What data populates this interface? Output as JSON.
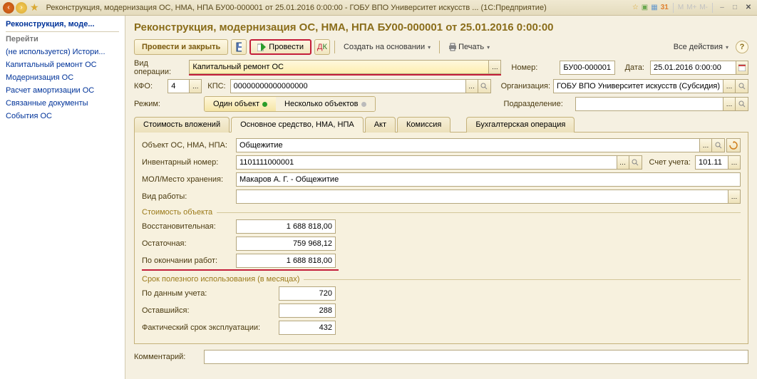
{
  "titlebar": {
    "title": "Реконструкция, модернизация ОС, НМА, НПА БУ00-000001 от 25.01.2016 0:00:00 - ГОБУ ВПО Университет искусств ... (1С:Предприятие)",
    "m": "M",
    "m_plus": "M+",
    "m_minus": "M-"
  },
  "sidebar": {
    "title": "Реконструкция, моде...",
    "nav_head": "Перейти",
    "items": [
      "(не используется) Истори...",
      "Капитальный ремонт ОС",
      "Модернизация ОС",
      "Расчет амортизации ОС",
      "Связанные документы",
      "События ОС"
    ]
  },
  "main": {
    "heading": "Реконструкция, модернизация ОС, НМА, НПА БУ00-000001 от 25.01.2016 0:00:00",
    "toolbar": {
      "post_close": "Провести и закрыть",
      "post": "Провести",
      "create_based": "Создать на основании",
      "print": "Печать",
      "all_actions": "Все действия"
    },
    "fields": {
      "op_type_label": "Вид операции:",
      "op_type_value": "Капитальный ремонт ОС",
      "number_label": "Номер:",
      "number_value": "БУ00-000001",
      "date_label": "Дата:",
      "date_value": "25.01.2016  0:00:00",
      "kfo_label": "КФО:",
      "kfo_value": "4",
      "kps_label": "КПС:",
      "kps_value": "00000000000000000",
      "org_label": "Организация:",
      "org_value": "ГОБУ ВПО Университет искусств (Субсидия)",
      "mode_label": "Режим:",
      "mode_one": "Один объект",
      "mode_many": "Несколько объектов",
      "dept_label": "Подразделение:",
      "dept_value": ""
    },
    "tabs": [
      "Стоимость вложений",
      "Основное средство, НМА, НПА",
      "Акт",
      "Комиссия",
      "Бухгалтерская операция"
    ],
    "active_tab": 1,
    "tabbody": {
      "object_label": "Объект ОС, НМА, НПА:",
      "object_value": "Общежитие",
      "inv_label": "Инвентарный номер:",
      "inv_value": "1101111000001",
      "acct_label": "Счет учета:",
      "acct_value": "101.11",
      "mol_label": "МОЛ/Место хранения:",
      "mol_value": "Макаров А. Г. - Общежитие",
      "work_label": "Вид работы:",
      "work_value": "",
      "group_cost": "Стоимость объекта",
      "restore_label": "Восстановительная:",
      "restore_value": "1 688 818,00",
      "residual_label": "Остаточная:",
      "residual_value": "759 968,12",
      "after_label": "По окончании работ:",
      "after_value": "1 688 818,00",
      "group_life": "Срок полезного использования (в месяцах)",
      "byacct_label": "По данным учета:",
      "byacct_value": "720",
      "remain_label": "Оставшийся:",
      "remain_value": "288",
      "actual_label": "Фактический срок эксплуатации:",
      "actual_value": "432"
    },
    "comment_label": "Комментарий:",
    "comment_value": ""
  }
}
